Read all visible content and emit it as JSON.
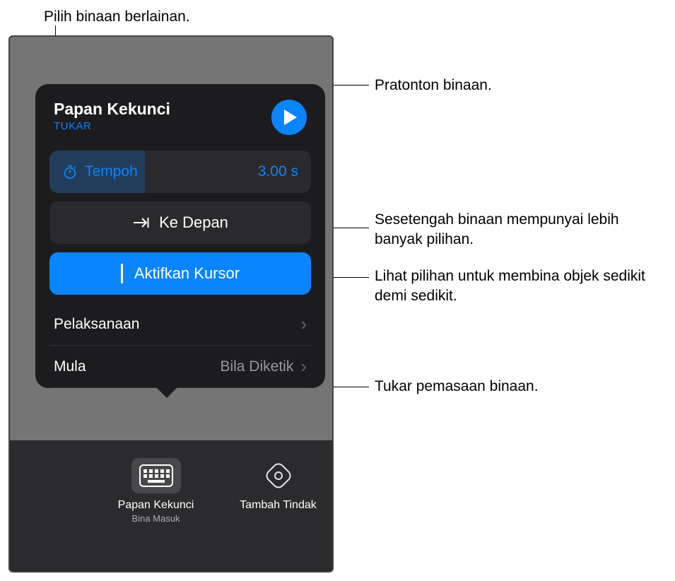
{
  "callouts": {
    "top": "Pilih binaan berlainan.",
    "play": "Pratonton binaan.",
    "forward": "Sesetengah binaan mempunyai lebih banyak pilihan.",
    "cursor": "Lihat pilihan untuk membina objek sedikit demi sedikit.",
    "start": "Tukar pemasaan binaan."
  },
  "popover": {
    "title": "Papan Kekunci",
    "change": "TUKAR",
    "duration": {
      "label": "Tempoh",
      "value": "3.00 s"
    },
    "forward": "Ke Depan",
    "cursor": "Aktifkan Kursor",
    "execution": "Pelaksanaan",
    "start": {
      "label": "Mula",
      "value": "Bila Diketik"
    }
  },
  "bottom": {
    "item1": {
      "title": "Papan Kekunci",
      "subtitle": "Bina Masuk"
    },
    "item2": {
      "title": "Tambah Tindak"
    }
  }
}
